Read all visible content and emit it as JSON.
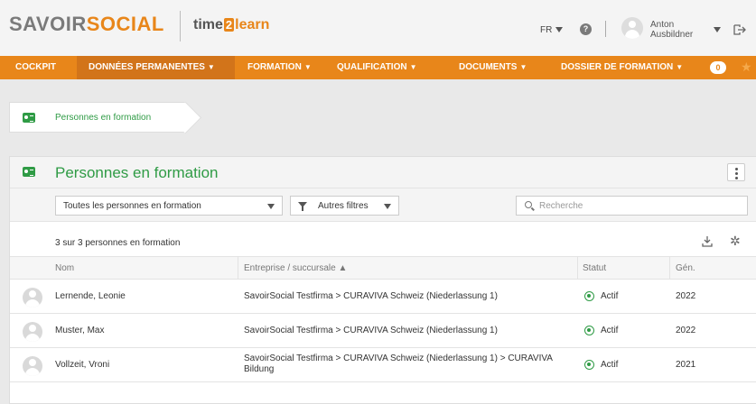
{
  "header": {
    "brand_part1": "SAVOIR",
    "brand_part2": "SOCIAL",
    "product_part1": "time",
    "product_part2": "2",
    "product_part3": "learn",
    "language": "FR",
    "user_name": "Anton",
    "user_role": "Ausbildner"
  },
  "nav": {
    "items": [
      {
        "label": "COCKPIT"
      },
      {
        "label": "DONNÉES PERMANENTES"
      },
      {
        "label": "FORMATION"
      },
      {
        "label": "QUALIFICATION"
      },
      {
        "label": "DOCUMENTS"
      },
      {
        "label": "DOSSIER DE FORMATION"
      }
    ],
    "dropdown_caret": "▼",
    "badge": "0",
    "star": "★"
  },
  "breadcrumb": {
    "label": "Personnes en formation"
  },
  "panel": {
    "title": "Personnes en formation",
    "filter_select_value": "Toutes les personnes en formation",
    "more_filters_label": "Autres filtres",
    "search_placeholder": "Recherche",
    "count_text": "3 sur 3 personnes en formation",
    "gear_glyph": "✲"
  },
  "table": {
    "columns": [
      {
        "label": "Nom"
      },
      {
        "label": "Entreprise / succursale ▲"
      },
      {
        "label": "Statut"
      },
      {
        "label": "Gén."
      }
    ],
    "rows": [
      {
        "name": "Lernende, Leonie",
        "company": "SavoirSocial Testfirma > CURAVIVA Schweiz (Niederlassung 1)",
        "status": "Actif",
        "gen": "2022"
      },
      {
        "name": "Muster, Max",
        "company": "SavoirSocial Testfirma > CURAVIVA Schweiz (Niederlassung 1)",
        "status": "Actif",
        "gen": "2022"
      },
      {
        "name": "Vollzeit, Vroni",
        "company": "SavoirSocial Testfirma > CURAVIVA Schweiz (Niederlassung 1) > CURAVIVA Bildung",
        "status": "Actif",
        "gen": "2021"
      }
    ]
  },
  "colors": {
    "accent": "#e8861a",
    "nav_active": "#d2741a",
    "green": "#2f9b45"
  }
}
